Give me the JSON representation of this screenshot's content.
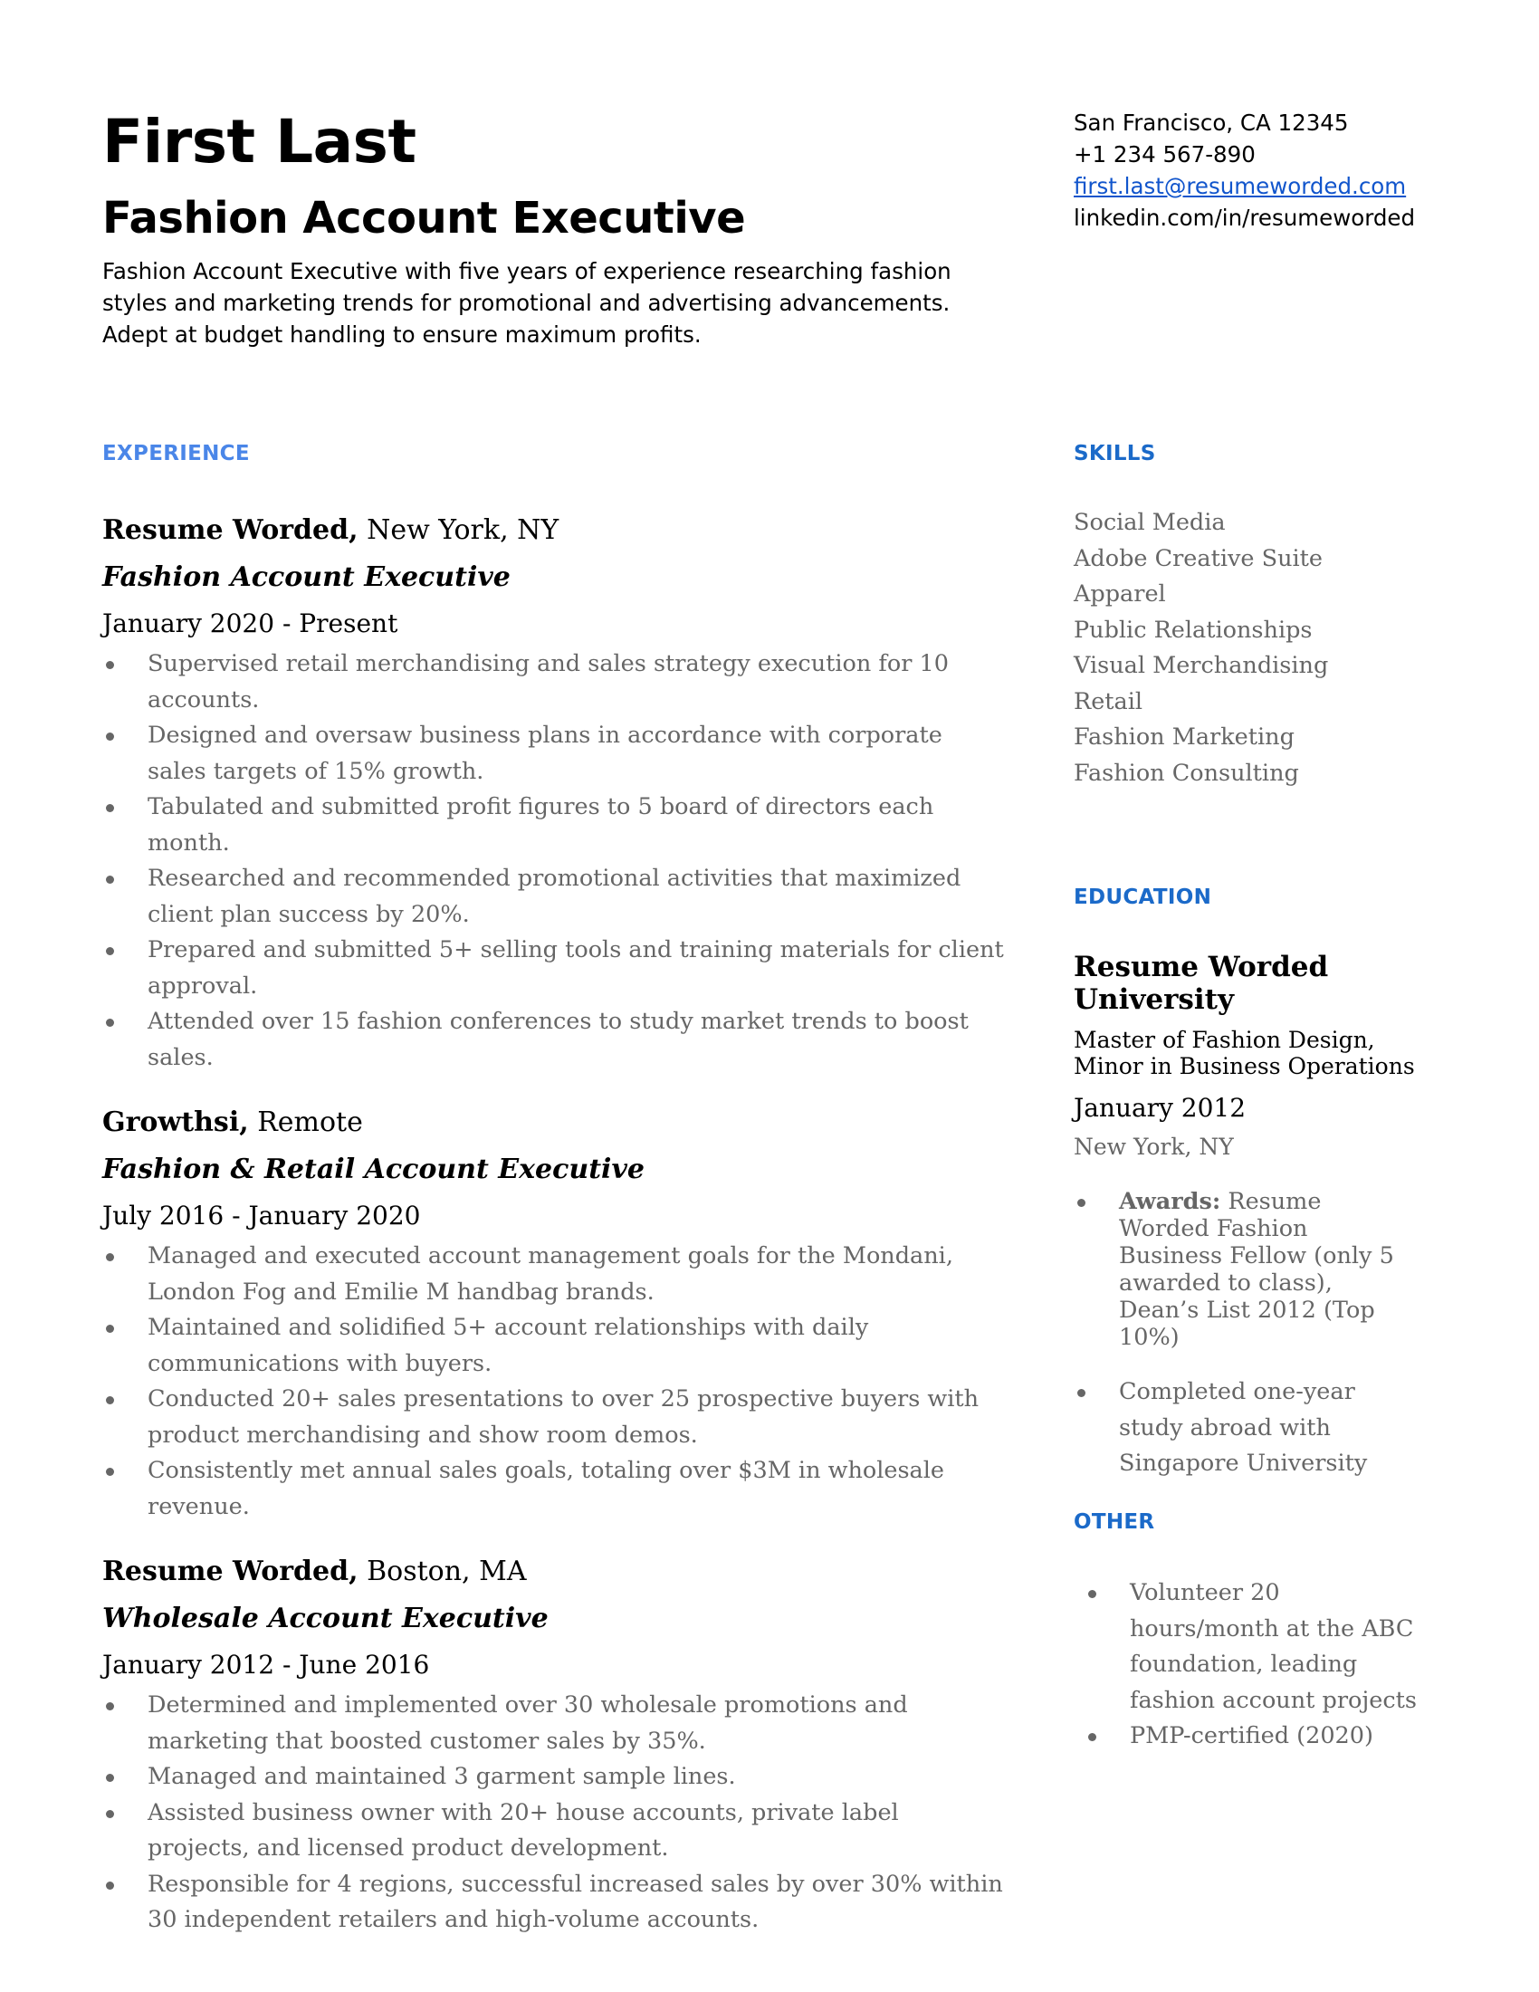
{
  "header": {
    "name": "First Last",
    "title": "Fashion Account Executive",
    "summary": "Fashion Account Executive with five years of experience researching fashion styles and marketing trends for promotional and advertising advancements. Adept at budget handling to ensure maximum profits."
  },
  "contact": {
    "location": "San Francisco, CA 12345",
    "phone": "+1 234 567-890",
    "email": "first.last@resumeworded.com",
    "linkedin": "linkedin.com/in/resumeworded"
  },
  "colors": {
    "experience_heading": "#4a86e8",
    "sidebar_heading": "#1b6ac9",
    "link": "#1155cc",
    "body_gray": "#666666"
  },
  "experience": {
    "heading": "EXPERIENCE",
    "jobs": [
      {
        "company": "Resume Worded,",
        "location": " New York, NY",
        "role": "Fashion Account Executive",
        "dates": "January 2020 - Present",
        "bullets": [
          "Supervised retail merchandising and sales strategy execution for 10 accounts.",
          "Designed and oversaw business plans in accordance with corporate sales targets of 15% growth.",
          "Tabulated and submitted profit figures to 5 board of directors each month.",
          "Researched and recommended promotional activities that maximized client plan success by 20%.",
          "Prepared and submitted 5+ selling tools and training materials for client approval.",
          "Attended over 15 fashion conferences to study market trends to boost sales."
        ]
      },
      {
        "company": "Growthsi,",
        "location": " Remote",
        "role": "Fashion & Retail Account Executive",
        "dates": "July 2016 - January 2020",
        "bullets": [
          "Managed and executed account management goals for the Mondani, London Fog and Emilie M handbag brands.",
          "Maintained and solidified 5+ account relationships with daily communications with buyers.",
          "Conducted 20+ sales presentations to over 25 prospective buyers with product merchandising and show room demos.",
          "Consistently met annual sales goals, totaling over $3M in wholesale revenue."
        ]
      },
      {
        "company": "Resume Worded,",
        "location": " Boston, MA",
        "role": "Wholesale Account Executive",
        "dates": "January 2012 - June 2016",
        "bullets": [
          "Determined and implemented over 30 wholesale promotions and marketing that boosted customer sales by 35%.",
          "Managed and maintained 3 garment sample lines.",
          "Assisted business owner with 20+ house accounts, private label projects, and licensed product development.",
          "Responsible for 4 regions, successful increased sales by over 30% within 30 independent retailers and high-volume accounts."
        ]
      }
    ]
  },
  "skills": {
    "heading": "SKILLS",
    "items": [
      "Social Media",
      "Adobe Creative Suite",
      "Apparel",
      "Public Relationships",
      "Visual Merchandising",
      "Retail",
      "Fashion Marketing",
      "Fashion Consulting"
    ]
  },
  "education": {
    "heading": "EDUCATION",
    "school": "Resume Worded University",
    "degree_line1": "Master of Fashion Design,",
    "degree_line2": "Minor in Business Operations",
    "date": "January 2012",
    "location": "New York, NY",
    "bullets": [
      {
        "label": "Awards:",
        "text": " Resume Worded Fashion Business Fellow (only 5 awarded to class), Dean’s List 2012 (Top 10%)"
      },
      {
        "label": "",
        "text": "Completed one-year study abroad with Singapore University"
      }
    ]
  },
  "other": {
    "heading": "OTHER",
    "items": [
      "Volunteer 20 hours/month at the ABC foundation, leading fashion account  projects",
      "PMP-certified (2020)"
    ]
  }
}
